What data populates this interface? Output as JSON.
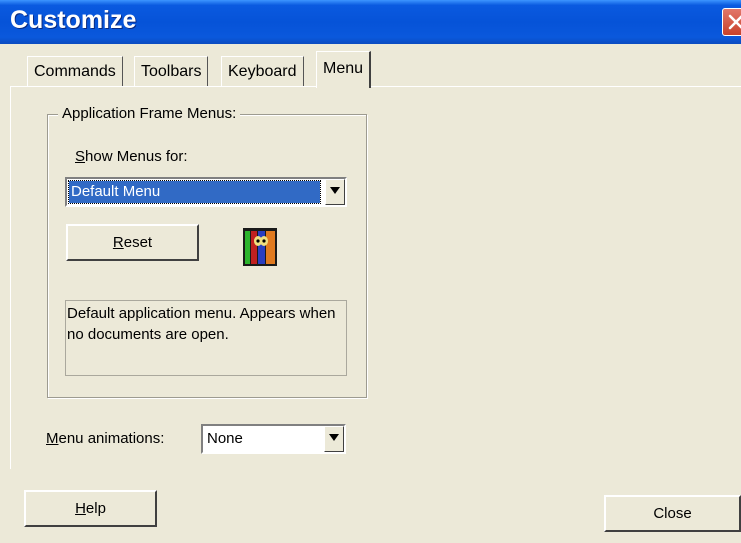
{
  "window": {
    "title": "Customize"
  },
  "tabs": [
    {
      "label": "Commands"
    },
    {
      "label": "Toolbars"
    },
    {
      "label": "Keyboard"
    },
    {
      "label": "Menu"
    }
  ],
  "group": {
    "label": "Application Frame Menus:",
    "show_menus_prefix": "S",
    "show_menus_rest": "how Menus for:",
    "show_menus_value": "Default Menu",
    "reset_prefix": "R",
    "reset_rest": "eset",
    "description": "Default application menu. Appears when no documents are open."
  },
  "animations": {
    "label_prefix": "M",
    "label_rest": "enu animations:",
    "value": "None"
  },
  "footer": {
    "help_prefix": "H",
    "help_rest": "elp",
    "close_label": "Close"
  },
  "colors": {
    "titlebar": "#0653d8",
    "dialog_bg": "#ece9d8",
    "selection": "#316ac5"
  }
}
